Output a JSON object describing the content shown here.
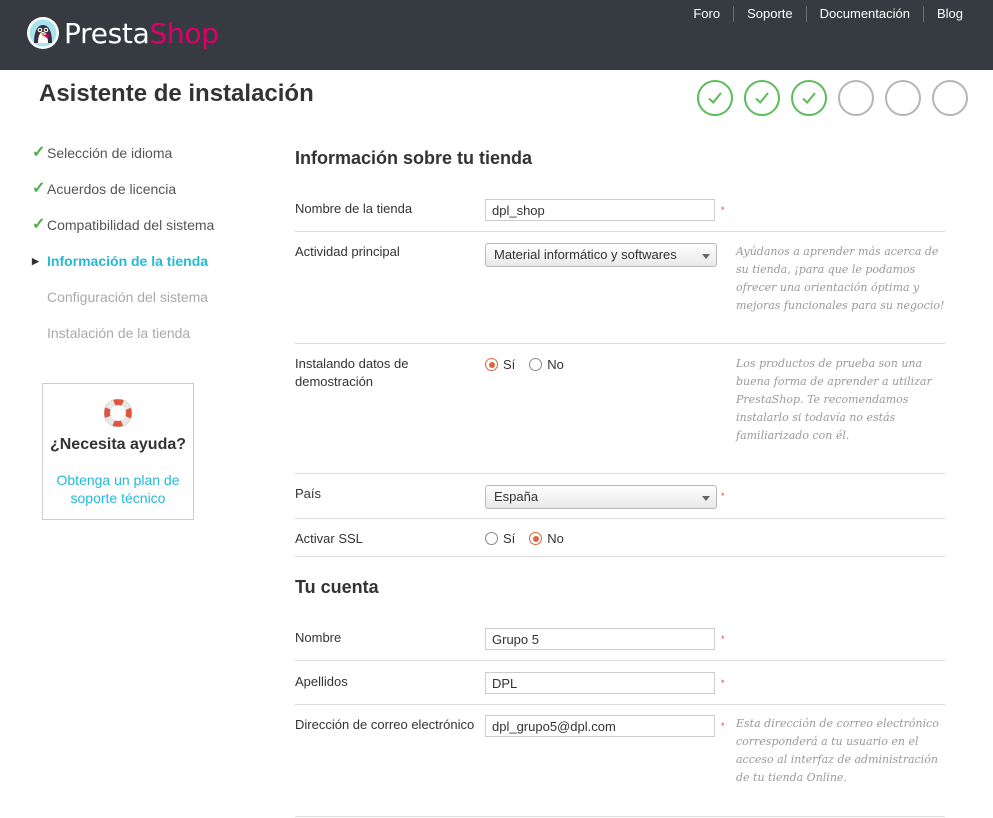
{
  "brand": {
    "name_part1": "Presta",
    "name_part2": "Shop",
    "colors": {
      "header_bg": "#363a41",
      "brand_pink": "#df0067",
      "accent": "#25b9d7",
      "check_green": "#5cbc5a",
      "radio_orange": "#e0633c"
    }
  },
  "topnav": {
    "links": [
      "Foro",
      "Soporte",
      "Documentación",
      "Blog"
    ]
  },
  "page_title": "Asistente de instalación",
  "progress": {
    "total_steps": 6,
    "completed_steps": 3
  },
  "sidebar": {
    "items": [
      {
        "label": "Selección de idioma",
        "state": "done"
      },
      {
        "label": "Acuerdos de licencia",
        "state": "done"
      },
      {
        "label": "Compatibilidad del sistema",
        "state": "done"
      },
      {
        "label": "Información de la tienda",
        "state": "current"
      },
      {
        "label": "Configuración del sistema",
        "state": "todo"
      },
      {
        "label": "Instalación de la tienda",
        "state": "todo"
      }
    ]
  },
  "help": {
    "icon": "lifebuoy-icon",
    "title": "¿Necesita ayuda?",
    "link": "Obtenga un plan de soporte técnico"
  },
  "store_section": {
    "title": "Información sobre tu tienda",
    "store_name": {
      "label": "Nombre de la tienda",
      "value": "dpl_shop",
      "required": "*"
    },
    "activity": {
      "label": "Actividad principal",
      "value": "Material informático y softwares",
      "hint": "Ayúdanos a aprender más acerca de su tienda, ¡para que le podamos ofrecer una orientación óptima y mejoras funcionales para su negocio!"
    },
    "demo_data": {
      "label": "Instalando datos de demostración",
      "options": [
        "Sí",
        "No"
      ],
      "selected": "Sí",
      "hint": "Los productos de prueba son una buena forma de aprender a utilizar PrestaShop. Te recomendamos instalarlo si todavía no estás familiarizado con él."
    },
    "country": {
      "label": "País",
      "value": "España",
      "required": "*"
    },
    "ssl": {
      "label": "Activar SSL",
      "options": [
        "Sí",
        "No"
      ],
      "selected": "No"
    }
  },
  "account_section": {
    "title": "Tu cuenta",
    "first_name": {
      "label": "Nombre",
      "value": "Grupo 5",
      "required": "*"
    },
    "last_name": {
      "label": "Apellidos",
      "value": "DPL",
      "required": "*"
    },
    "email": {
      "label": "Dirección de correo electrónico",
      "value": "dpl_grupo5@dpl.com",
      "required": "*",
      "hint": "Esta dirección de correo electrónico corresponderá a tu usuario en el acceso al interfaz de administración de tu tienda Online."
    }
  }
}
